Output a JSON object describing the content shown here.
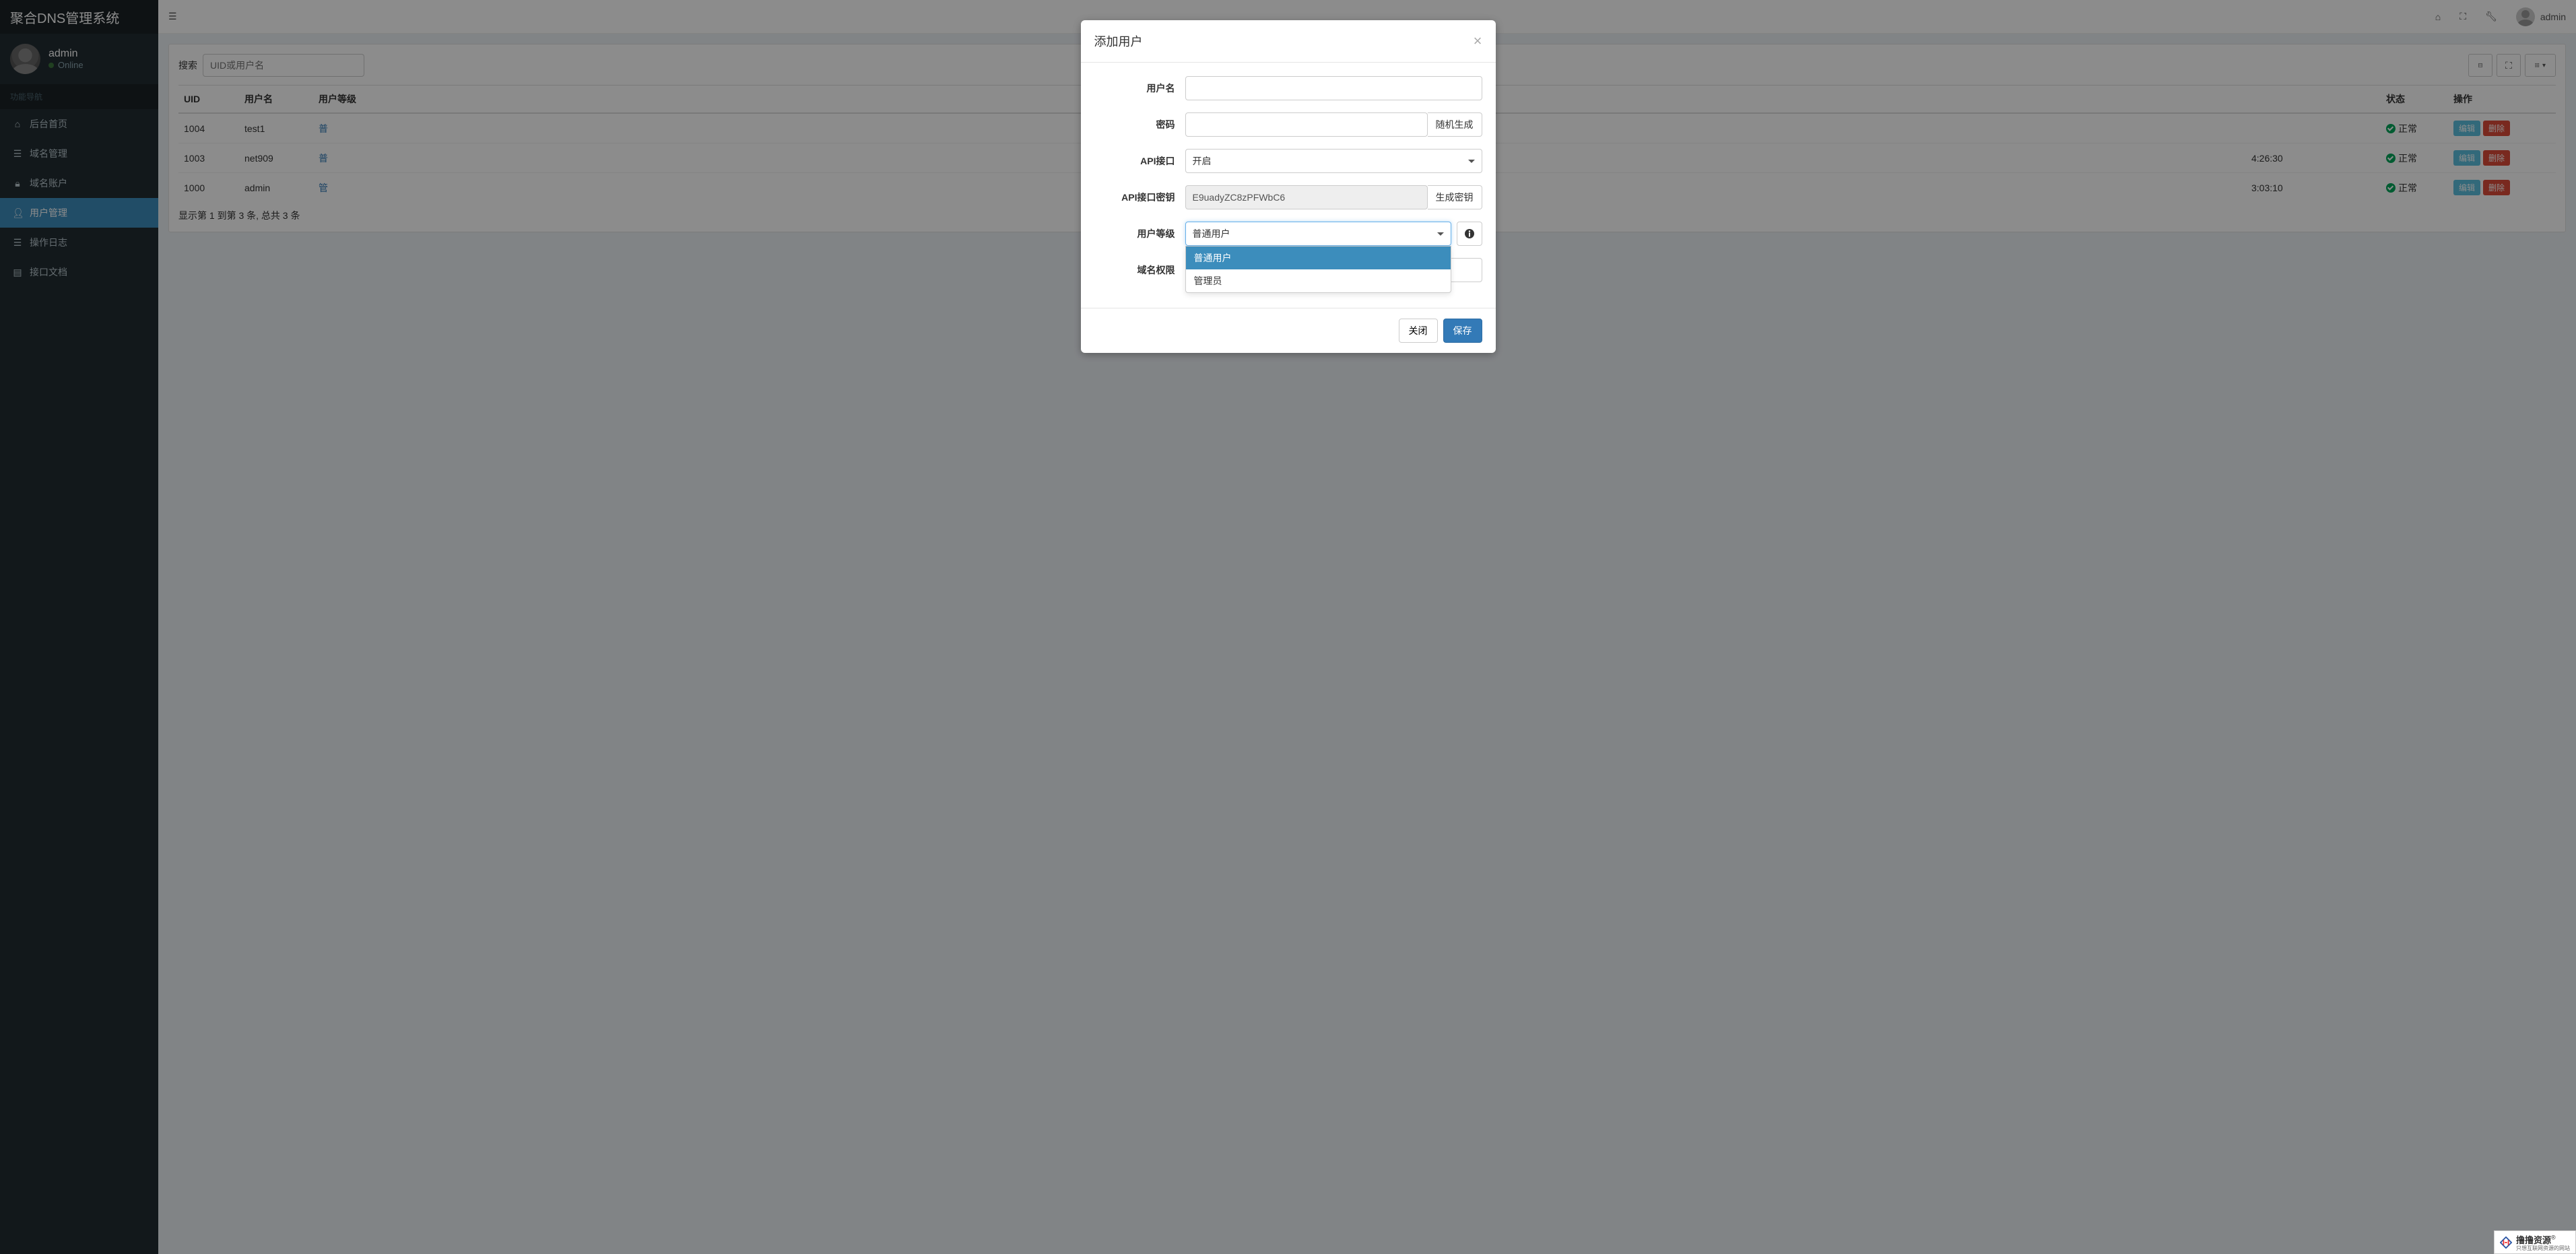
{
  "brand": "聚合DNS管理系统",
  "user": {
    "name": "admin",
    "status": "Online"
  },
  "sidebar": {
    "section_header": "功能导航",
    "items": [
      {
        "label": "后台首页",
        "icon": "home"
      },
      {
        "label": "域名管理",
        "icon": "list"
      },
      {
        "label": "域名账户",
        "icon": "lock"
      },
      {
        "label": "用户管理",
        "icon": "user",
        "active": true
      },
      {
        "label": "操作日志",
        "icon": "lines"
      },
      {
        "label": "接口文档",
        "icon": "book"
      }
    ]
  },
  "topbar": {
    "user": "admin"
  },
  "search": {
    "label": "搜索",
    "placeholder": "UID或用户名"
  },
  "table": {
    "headers": {
      "uid": "UID",
      "username": "用户名",
      "level": "用户等级",
      "status": "状态",
      "action": "操作"
    },
    "rows": [
      {
        "uid": "1004",
        "username": "test1",
        "level_char": "普",
        "last_time": "",
        "status": "正常"
      },
      {
        "uid": "1003",
        "username": "net909",
        "level_char": "普",
        "last_time": "4:26:30",
        "status": "正常"
      },
      {
        "uid": "1000",
        "username": "admin",
        "level_char": "管",
        "last_time": "3:03:10",
        "status": "正常"
      }
    ],
    "action_labels": {
      "edit": "编辑",
      "delete": "删除"
    },
    "footer": "显示第 1 到第 3 条, 总共 3 条"
  },
  "modal": {
    "title": "添加用户",
    "fields": {
      "username": {
        "label": "用户名",
        "value": ""
      },
      "password": {
        "label": "密码",
        "value": "",
        "gen": "随机生成"
      },
      "api": {
        "label": "API接口",
        "value": "开启"
      },
      "apikey": {
        "label": "API接口密钥",
        "value": "E9uadyZC8zPFWbC6",
        "gen": "生成密钥"
      },
      "level": {
        "label": "用户等级",
        "value": "普通用户",
        "options": [
          "普通用户",
          "管理员"
        ]
      },
      "domain": {
        "label": "域名权限",
        "value": ""
      }
    },
    "buttons": {
      "close": "关闭",
      "save": "保存"
    }
  },
  "watermark": {
    "main": "撸撸资源",
    "sub": "只想互联网资源的网站"
  }
}
